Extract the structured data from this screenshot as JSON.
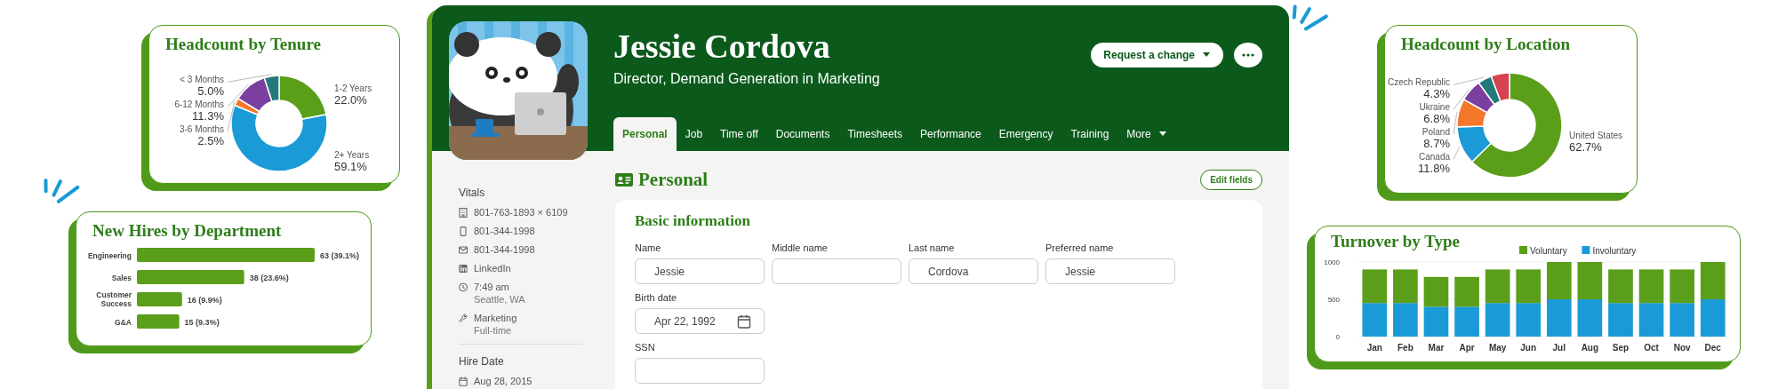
{
  "tenure_card": {
    "title": "Headcount by Tenure",
    "chart_data": {
      "type": "donut",
      "categories": [
        "1-2 Years",
        "2+ Years",
        "3-6 Months",
        "6-12 Months",
        "< 3 Months"
      ],
      "values": [
        22.0,
        59.1,
        2.5,
        11.3,
        5.0
      ],
      "colors": [
        "#5a9e1a",
        "#1a9ad6",
        "#f5772a",
        "#7b3fa0",
        "#237a7a"
      ],
      "value_labels": [
        "22.0%",
        "59.1%",
        "2.5%",
        "11.3%",
        "5.0%"
      ]
    }
  },
  "hires_card": {
    "title": "New Hires by Department",
    "chart_data": {
      "type": "bar",
      "orientation": "horizontal",
      "categories": [
        "Engineering",
        "Sales",
        "Customer Success",
        "G&A"
      ],
      "values": [
        63,
        38,
        16,
        15
      ],
      "colors": [
        "#5a9e1a",
        "#5a9e1a",
        "#5a9e1a",
        "#5a9e1a"
      ],
      "value_labels": [
        "63 (39.1%)",
        "38 (23.6%)",
        "16 (9.9%)",
        "15 (9.3%)"
      ]
    }
  },
  "profile": {
    "name": "Jessie Cordova",
    "job_title": "Director, Demand Generation in Marketing",
    "request_button": "Request a change",
    "tabs": [
      {
        "label": "Personal",
        "selected": true,
        "kind": "tab"
      },
      {
        "label": "Job",
        "selected": false,
        "kind": "tab"
      },
      {
        "label": "Time off",
        "selected": false,
        "kind": "tab"
      },
      {
        "label": "Documents",
        "selected": false,
        "kind": "tab"
      },
      {
        "label": "Timesheets",
        "selected": false,
        "kind": "tab"
      },
      {
        "label": "Performance",
        "selected": false,
        "kind": "tab"
      },
      {
        "label": "Emergency",
        "selected": false,
        "kind": "tab"
      },
      {
        "label": "Training",
        "selected": false,
        "kind": "tab"
      },
      {
        "label": "More",
        "selected": false,
        "kind": "menu"
      }
    ],
    "sidebar": [
      {
        "heading": "Vitals",
        "items": [
          {
            "kind": "office",
            "lines": [
              "801-763-1893 × 6109"
            ]
          },
          {
            "kind": "mobile",
            "lines": [
              "801-344-1998"
            ]
          },
          {
            "kind": "mail",
            "lines": [
              "801-344-1998"
            ]
          },
          {
            "kind": "linkedin",
            "lines": [
              "LinkedIn"
            ]
          },
          {
            "kind": "clock",
            "lines": [
              "7:49 am",
              "Seattle, WA"
            ]
          },
          {
            "kind": "wrench",
            "lines": [
              "Marketing",
              "Full-time"
            ]
          }
        ]
      },
      {
        "heading": "Hire Date",
        "items": [
          {
            "kind": "calendar",
            "lines": [
              "Aug 28, 2015"
            ]
          }
        ]
      }
    ],
    "section": {
      "title": "Personal",
      "edit_button": "Edit fields",
      "card_title": "Basic information",
      "rows": [
        [
          {
            "label": "Name",
            "value": "Jessie",
            "kind": "text"
          },
          {
            "label": "Middle name",
            "kind": "text"
          },
          {
            "label": "Last name",
            "value": "Cordova",
            "kind": "text"
          },
          {
            "label": "Preferred name",
            "value": "Jessie",
            "kind": "text"
          }
        ],
        [
          {
            "label": "Birth date",
            "value": "Apr 22, 1992",
            "kind": "date"
          }
        ],
        [
          {
            "label": "SSN",
            "kind": "text"
          }
        ]
      ]
    }
  },
  "location_card": {
    "title": "Headcount by Location",
    "chart_data": {
      "type": "donut",
      "categories": [
        "United States",
        "Canada",
        "Poland",
        "Ukraine",
        "Czech Republic",
        null
      ],
      "values": [
        62.7,
        11.8,
        8.7,
        6.8,
        4.3,
        5.7
      ],
      "colors": [
        "#5a9e1a",
        "#1a9ad6",
        "#f5772a",
        "#7b3fa0",
        "#237a7a",
        "#d4434f"
      ],
      "value_labels": [
        "62.7%",
        "11.8%",
        "8.7%",
        "6.8%",
        "4.3%",
        null
      ]
    }
  },
  "turnover_card": {
    "title": "Turnover by Type",
    "chart_data": {
      "type": "bar",
      "stacked": true,
      "legend": "top",
      "categories": [
        "Jan",
        "Feb",
        "Mar",
        "Apr",
        "May",
        "Jun",
        "Jul",
        "Aug",
        "Sep",
        "Oct",
        "Nov",
        "Dec"
      ],
      "ylim": [
        0,
        1000
      ],
      "yticks": [
        0,
        500,
        1000
      ],
      "series": [
        {
          "name": "Voluntary",
          "color": "#5a9e1a",
          "values": [
            450,
            450,
            400,
            400,
            450,
            450,
            500,
            500,
            450,
            450,
            450,
            500
          ]
        },
        {
          "name": "Involuntary",
          "color": "#1a9ad6",
          "values": [
            450,
            450,
            400,
            400,
            450,
            450,
            500,
            500,
            450,
            450,
            450,
            500
          ]
        }
      ]
    }
  }
}
